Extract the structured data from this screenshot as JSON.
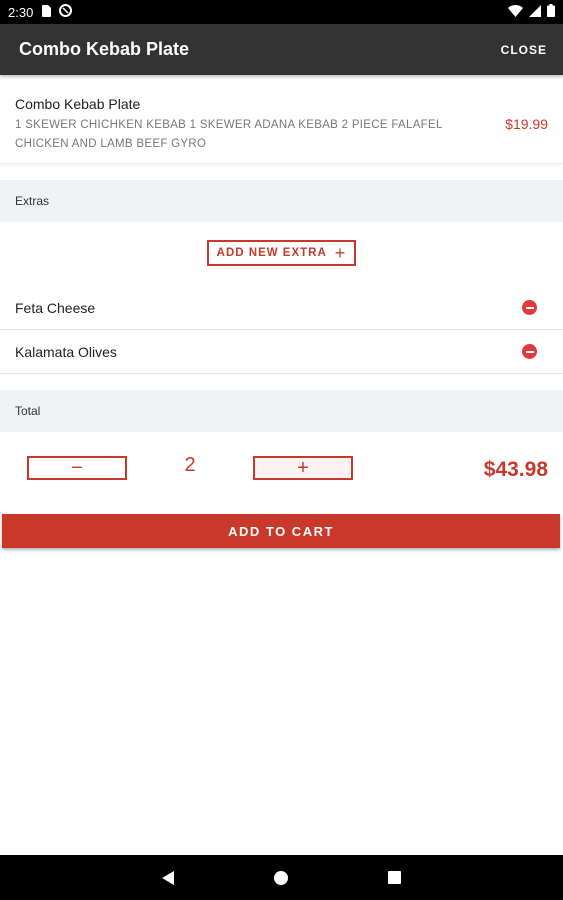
{
  "status_bar": {
    "time": "2:30"
  },
  "app_bar": {
    "title": "Combo Kebab Plate",
    "close_label": "CLOSE"
  },
  "item": {
    "name": "Combo Kebab Plate",
    "description": "1 SKEWER CHICHKEN KEBAB 1 SKEWER ADANA KEBAB 2 PIECE FALAFEL CHICKEN AND LAMB BEEF GYRO",
    "price": "$19.99"
  },
  "extras_section": {
    "heading": "Extras",
    "add_button_label": "ADD NEW EXTRA",
    "items": [
      {
        "label": "Feta Cheese"
      },
      {
        "label": "Kalamata Olives"
      }
    ]
  },
  "total_section": {
    "heading": "Total",
    "quantity": "2",
    "minus_symbol": "−",
    "plus_symbol": "+",
    "total_price": "$43.98"
  },
  "add_to_cart_label": "ADD TO CART",
  "colors": {
    "accent": "#c6392b",
    "app_bar": "#333333",
    "section_bg": "#f1f2f4",
    "remove_icon": "#e0393e"
  },
  "icons": {
    "status": [
      "sim-card-icon",
      "data-saver-icon",
      "wifi-icon",
      "signal-icon",
      "battery-icon"
    ],
    "nav": [
      "back-icon",
      "home-icon",
      "recents-icon"
    ]
  }
}
